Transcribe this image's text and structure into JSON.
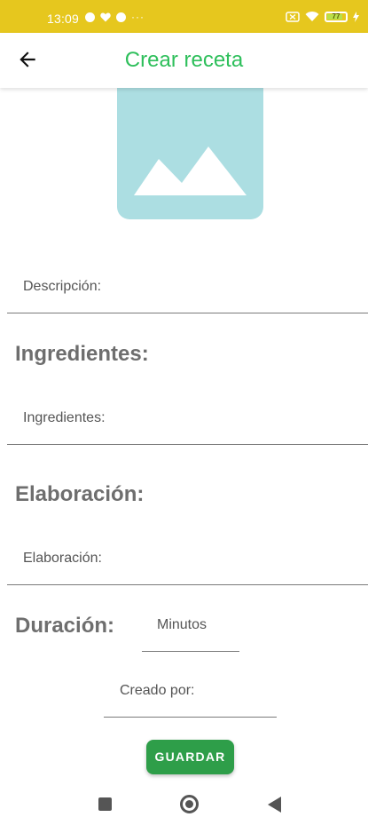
{
  "status_bar": {
    "time": "13:09",
    "overflow": "···",
    "battery_level": "77",
    "icons": [
      "notification-icon",
      "heart-icon",
      "notification-icon",
      "no-sim-icon",
      "wifi-icon",
      "battery-icon",
      "charging-icon"
    ]
  },
  "app_bar": {
    "title": "Crear receta",
    "back_icon": "arrow-left-icon"
  },
  "colors": {
    "status_bar": "#e6c71e",
    "title": "#2ebf5b",
    "image_placeholder": "#acdee2",
    "save_button": "#2e9e49",
    "section_title": "#6e6e6e"
  },
  "form": {
    "image_icon": "image-placeholder-icon",
    "description_label": "Descripción:",
    "ingredients_title": "Ingredientes:",
    "ingredients_label": "Ingredientes:",
    "elaboration_title": "Elaboración:",
    "elaboration_label": "Elaboración:",
    "duration_title": "Duración:",
    "minutes_label": "Minutos",
    "created_by_label": "Creado por:",
    "save_label": "GUARDAR"
  },
  "nav_bar": {
    "icons": [
      "recents-icon",
      "home-icon",
      "back-icon"
    ]
  }
}
